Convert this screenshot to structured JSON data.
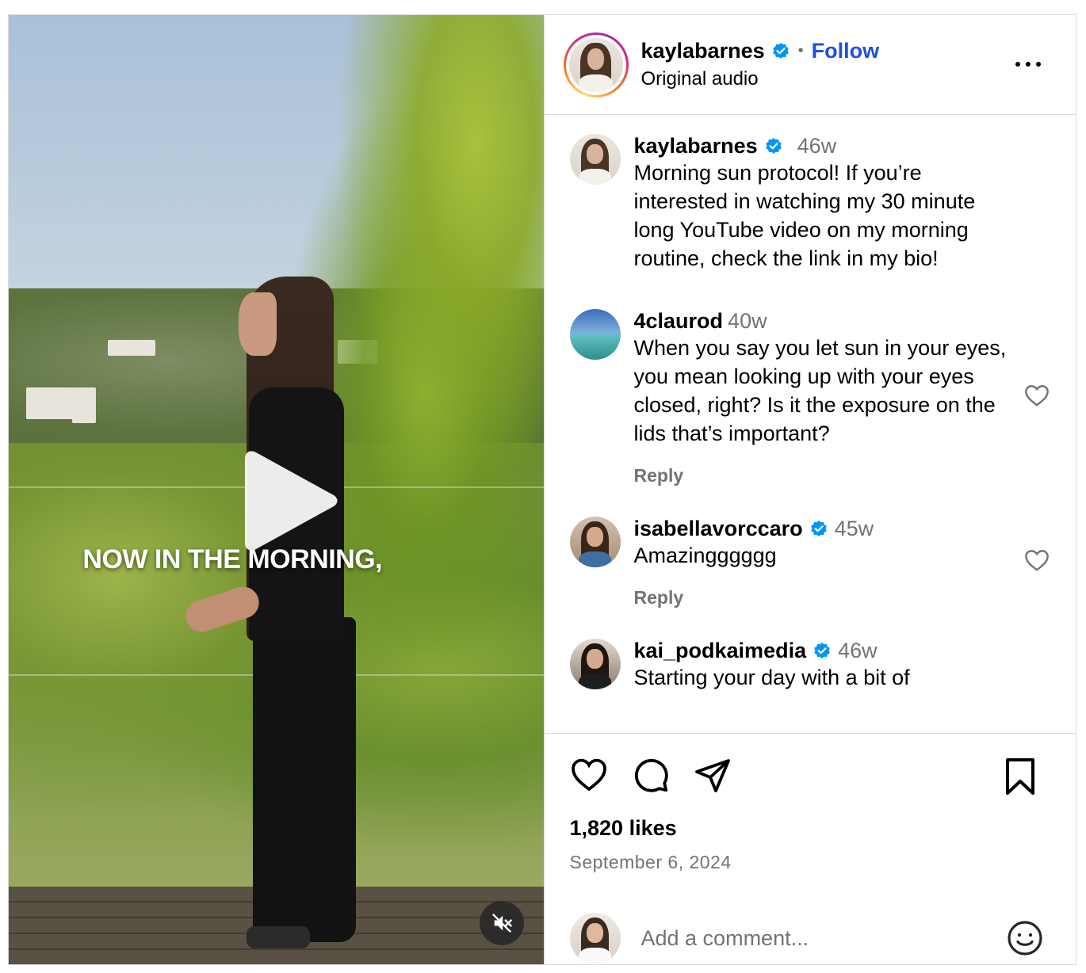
{
  "media": {
    "overlay_text": "NOW IN THE MORNING,"
  },
  "header": {
    "username": "kaylabarnes",
    "separator": "•",
    "follow_label": "Follow",
    "audio_label": "Original audio"
  },
  "comments": [
    {
      "username": "kaylabarnes",
      "verified": true,
      "time": "46w",
      "text": "Morning sun protocol! If you’re interested in watching my 30 minute long YouTube video on my morning routine, check the link in my bio!"
    },
    {
      "username": "4claurod",
      "verified": false,
      "time": "40w",
      "text": "When you say you let sun in your eyes, you mean looking up with your eyes closed, right? Is it the exposure on the lids that’s important?",
      "reply_label": "Reply"
    },
    {
      "username": "isabellavorccaro",
      "verified": true,
      "time": "45w",
      "text": "Amazingggggg",
      "reply_label": "Reply"
    },
    {
      "username": "kai_podkaimedia",
      "verified": true,
      "time": "46w",
      "text": "Starting your day with a bit of"
    }
  ],
  "actions": {
    "likes": "1,820 likes",
    "date": "September 6, 2024"
  },
  "add_comment": {
    "placeholder": "Add a comment..."
  },
  "colors": {
    "verified": "#0095f6",
    "follow": "#1f4fe0",
    "muted": "#737373",
    "border": "#dbdbdb"
  },
  "icons": [
    "play-icon",
    "mute-icon",
    "more-icon",
    "verified-icon",
    "heart-icon",
    "comment-icon",
    "share-icon",
    "bookmark-icon",
    "emoji-icon"
  ]
}
